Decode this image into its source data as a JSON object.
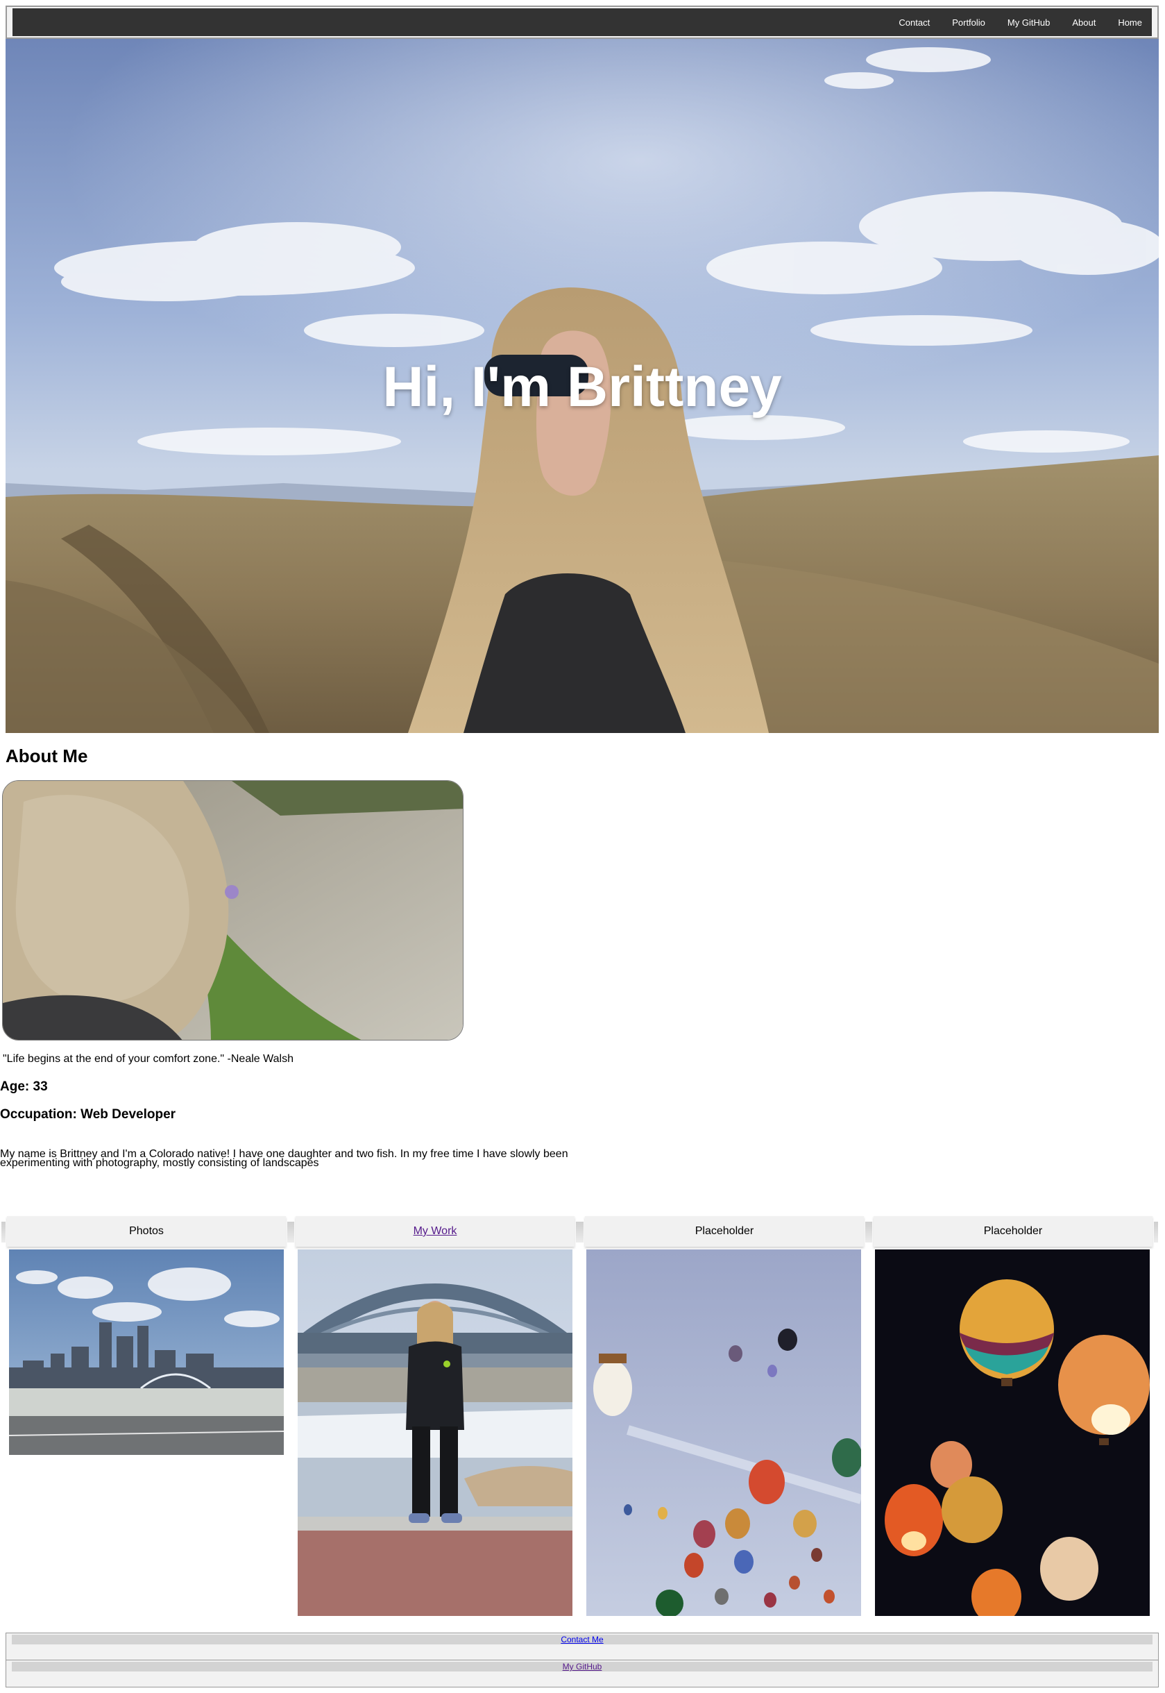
{
  "nav": {
    "links": [
      {
        "label": "Contact"
      },
      {
        "label": "Portfolio"
      },
      {
        "label": "My GitHub"
      },
      {
        "label": "About"
      },
      {
        "label": "Home"
      }
    ]
  },
  "hero": {
    "title": "Hi, I'm Brittney"
  },
  "about": {
    "heading": "About Me",
    "quote": "\"Life begins at the end of your comfort zone.\" -Neale Walsh",
    "age": "Age: 33",
    "occupation": "Occupation: Web Developer",
    "bio": "My name is Brittney and I'm a Colorado native! I have one daughter and two fish. In my free time I have slowly been experimenting with photography, mostly consisting of landscapes"
  },
  "cards": [
    {
      "label": "Photos"
    },
    {
      "label": "My Work"
    },
    {
      "label": "Placeholder"
    },
    {
      "label": "Placeholder"
    }
  ],
  "footer": {
    "contact_label": "Contact Me",
    "github_label": "My GitHub"
  },
  "colors": {
    "nav_bg": "#333333",
    "visited_link": "#551a8b",
    "link": "#0000ee"
  }
}
